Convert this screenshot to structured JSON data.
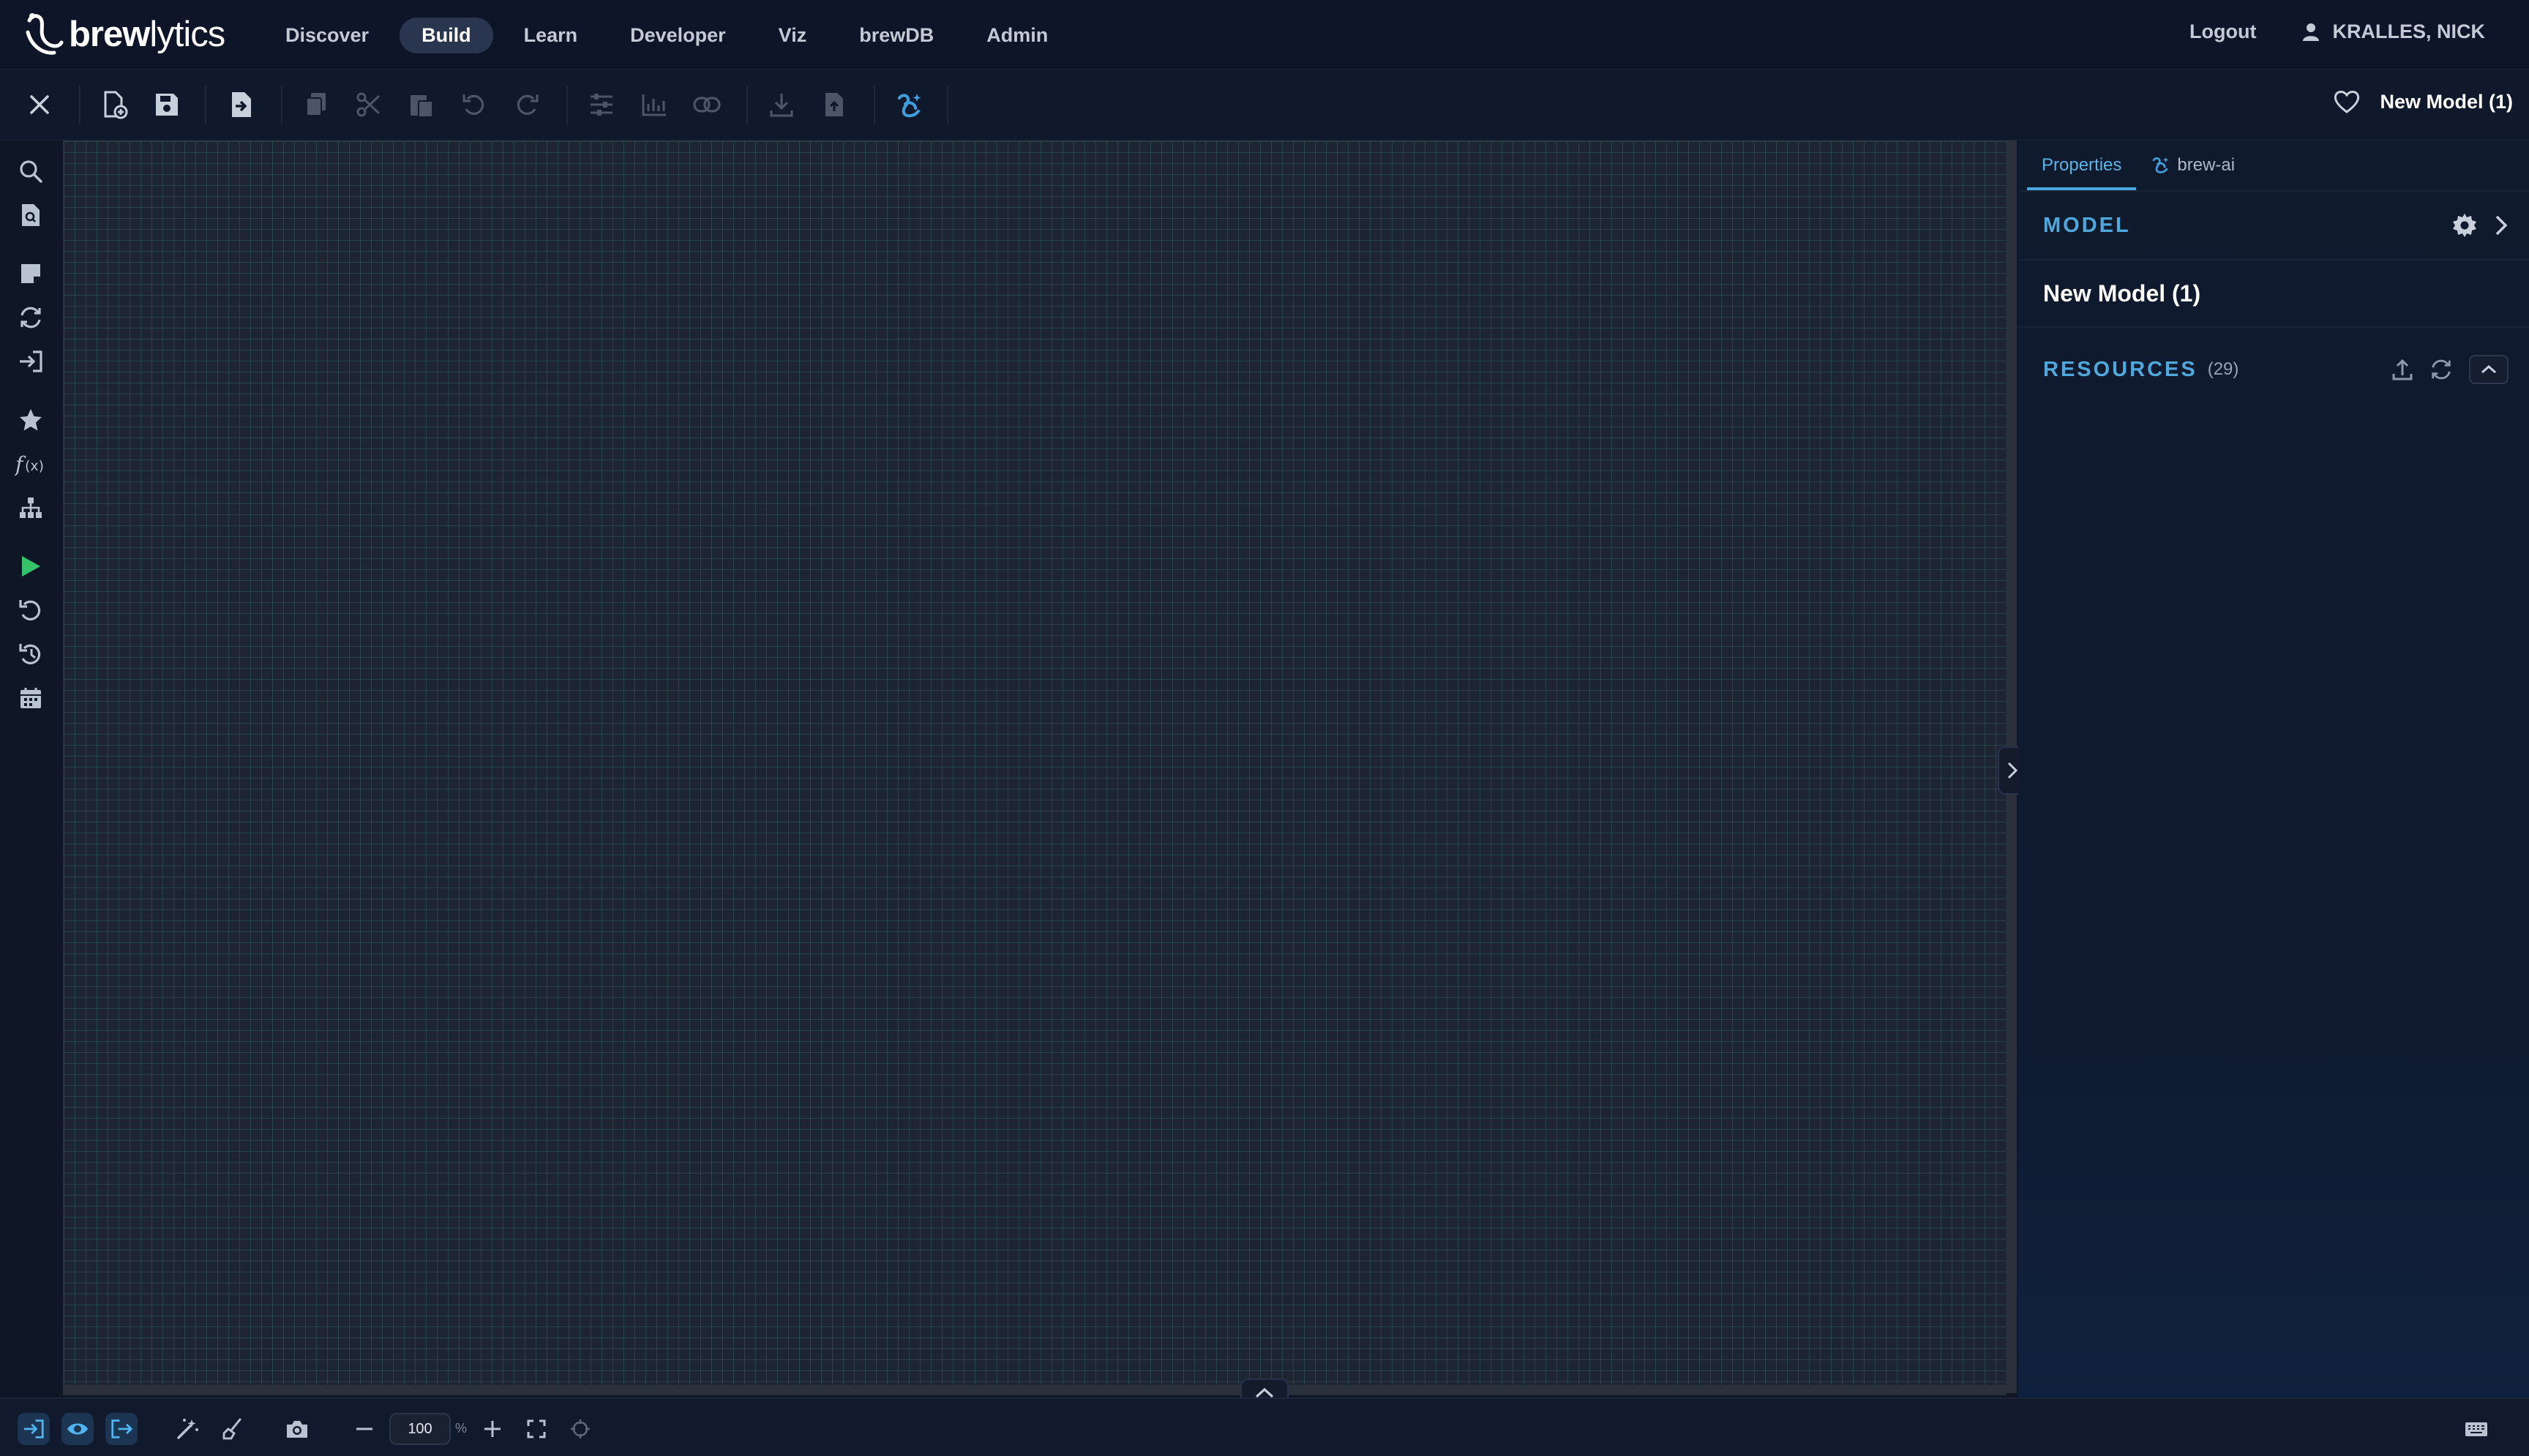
{
  "app": {
    "logo_bold": "brew",
    "logo_light": "lytics"
  },
  "nav": {
    "items": [
      {
        "label": "Discover",
        "active": false
      },
      {
        "label": "Build",
        "active": true
      },
      {
        "label": "Learn",
        "active": false
      },
      {
        "label": "Developer",
        "active": false
      },
      {
        "label": "Viz",
        "active": false
      },
      {
        "label": "brewDB",
        "active": false
      },
      {
        "label": "Admin",
        "active": false
      }
    ],
    "logout": "Logout",
    "user": "KRALLES, NICK"
  },
  "toolbar": {
    "model_title": "New Model (1)",
    "icons": [
      "close-icon",
      "new-file-icon",
      "save-icon",
      "import-icon",
      "copy-icon",
      "cut-icon",
      "paste-icon",
      "undo-icon",
      "redo-icon",
      "sliders-icon",
      "chart-icon",
      "link-icon",
      "download-icon",
      "export-icon",
      "brew-ai-icon",
      "heart-icon"
    ]
  },
  "leftbar": {
    "icons": [
      "search-icon",
      "file-search-icon",
      "note-icon",
      "sync-icon",
      "sign-in-icon",
      "star-icon",
      "function-icon",
      "hierarchy-icon",
      "play-icon",
      "reset-icon",
      "history-icon",
      "calendar-icon"
    ]
  },
  "panel": {
    "tabs": [
      {
        "label": "Properties",
        "active": true
      },
      {
        "label": "brew-ai",
        "active": false
      }
    ],
    "model_section": "MODEL",
    "model_name": "New Model (1)",
    "resources_section": "RESOURCES",
    "resources_count": "(29)"
  },
  "statusbar": {
    "zoom_value": "100",
    "zoom_unit": "%"
  },
  "colors": {
    "accent": "#4fa8dc",
    "play": "#35c46a",
    "canvas": "#1d2532",
    "grid": "#387878"
  }
}
